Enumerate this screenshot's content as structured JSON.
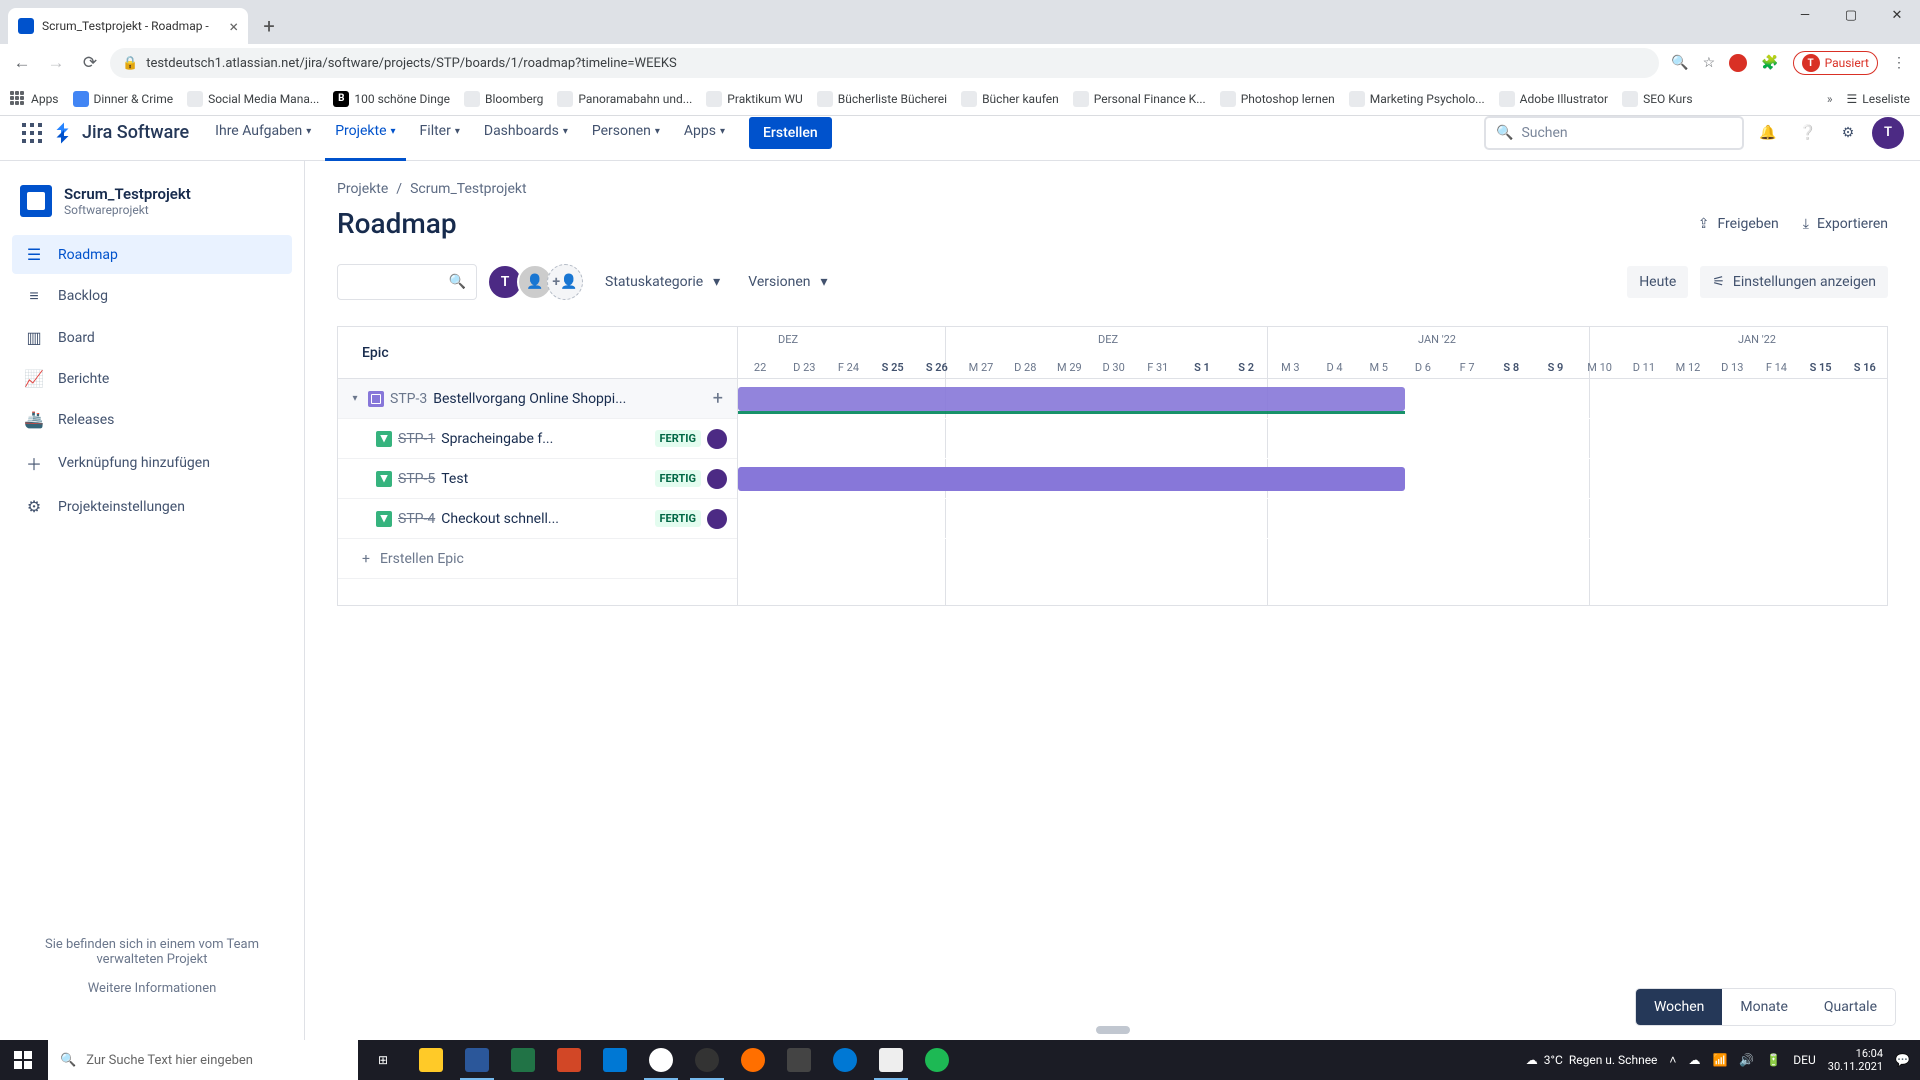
{
  "browser": {
    "tab_title": "Scrum_Testprojekt - Roadmap - ",
    "url": "testdeutsch1.atlassian.net/jira/software/projects/STP/boards/1/roadmap?timeline=WEEKS",
    "pause_label": "Pausiert",
    "bookmarks": [
      "Apps",
      "Dinner & Crime",
      "Social Media Mana...",
      "100 schöne Dinge",
      "Bloomberg",
      "Panoramabahn und...",
      "Praktikum WU",
      "Bücherliste Bücherei",
      "Bücher kaufen",
      "Personal Finance K...",
      "Photoshop lernen",
      "Marketing Psycholo...",
      "Adobe Illustrator",
      "SEO Kurs"
    ],
    "bm_right": "Leseliste"
  },
  "header": {
    "logo": "Jira Software",
    "nav": [
      "Ihre Aufgaben",
      "Projekte",
      "Filter",
      "Dashboards",
      "Personen",
      "Apps"
    ],
    "create": "Erstellen",
    "search_ph": "Suchen"
  },
  "sidebar": {
    "project": "Scrum_Testprojekt",
    "project_sub": "Softwareprojekt",
    "items": [
      "Roadmap",
      "Backlog",
      "Board",
      "Berichte",
      "Releases",
      "Verknüpfung hinzufügen",
      "Projekteinstellungen"
    ],
    "note": "Sie befinden sich in einem vom Team verwalteten Projekt",
    "note_link": "Weitere Informationen"
  },
  "crumbs": {
    "root": "Projekte",
    "leaf": "Scrum_Testprojekt",
    "sep": "/"
  },
  "page": {
    "title": "Roadmap",
    "share": "Freigeben",
    "export": "Exportieren"
  },
  "filters": {
    "status": "Statuskategorie",
    "versions": "Versionen",
    "today": "Heute",
    "settings": "Einstellungen anzeigen"
  },
  "timeline": {
    "months": [
      {
        "label": "DEZ",
        "pos": 50
      },
      {
        "label": "DEZ",
        "pos": 370
      },
      {
        "label": "JAN '22",
        "pos": 670
      },
      {
        "label": "JAN '22",
        "pos": 1000
      }
    ],
    "days": [
      "22",
      "D 23",
      "F 24",
      "S 25",
      "S 26",
      "M 27",
      "D 28",
      "M 29",
      "D 30",
      "F 31",
      "S 1",
      "S 2",
      "M 3",
      "D 4",
      "M 5",
      "D 6",
      "F 7",
      "S 8",
      "S 9",
      "M 10",
      "D 11",
      "M 12",
      "D 13",
      "F 14",
      "S 15",
      "S 16"
    ],
    "scale": [
      "Wochen",
      "Monate",
      "Quartale"
    ]
  },
  "roadmap": {
    "epic_header": "Epic",
    "epic": {
      "key": "STP-3",
      "summary": "Bestellvorgang Online Shoppi..."
    },
    "stories": [
      {
        "key": "STP-1",
        "summary": "Spracheingabe f...",
        "status": "FERTIG"
      },
      {
        "key": "STP-5",
        "summary": "Test",
        "status": "FERTIG"
      },
      {
        "key": "STP-4",
        "summary": "Checkout schnell...",
        "status": "FERTIG"
      }
    ],
    "create": "Erstellen Epic"
  },
  "taskbar": {
    "search_ph": "Zur Suche Text hier eingeben",
    "weather_temp": "3°C",
    "weather_txt": "Regen u. Schnee",
    "time": "16:04",
    "date": "30.11.2021",
    "lang": "DEU"
  }
}
